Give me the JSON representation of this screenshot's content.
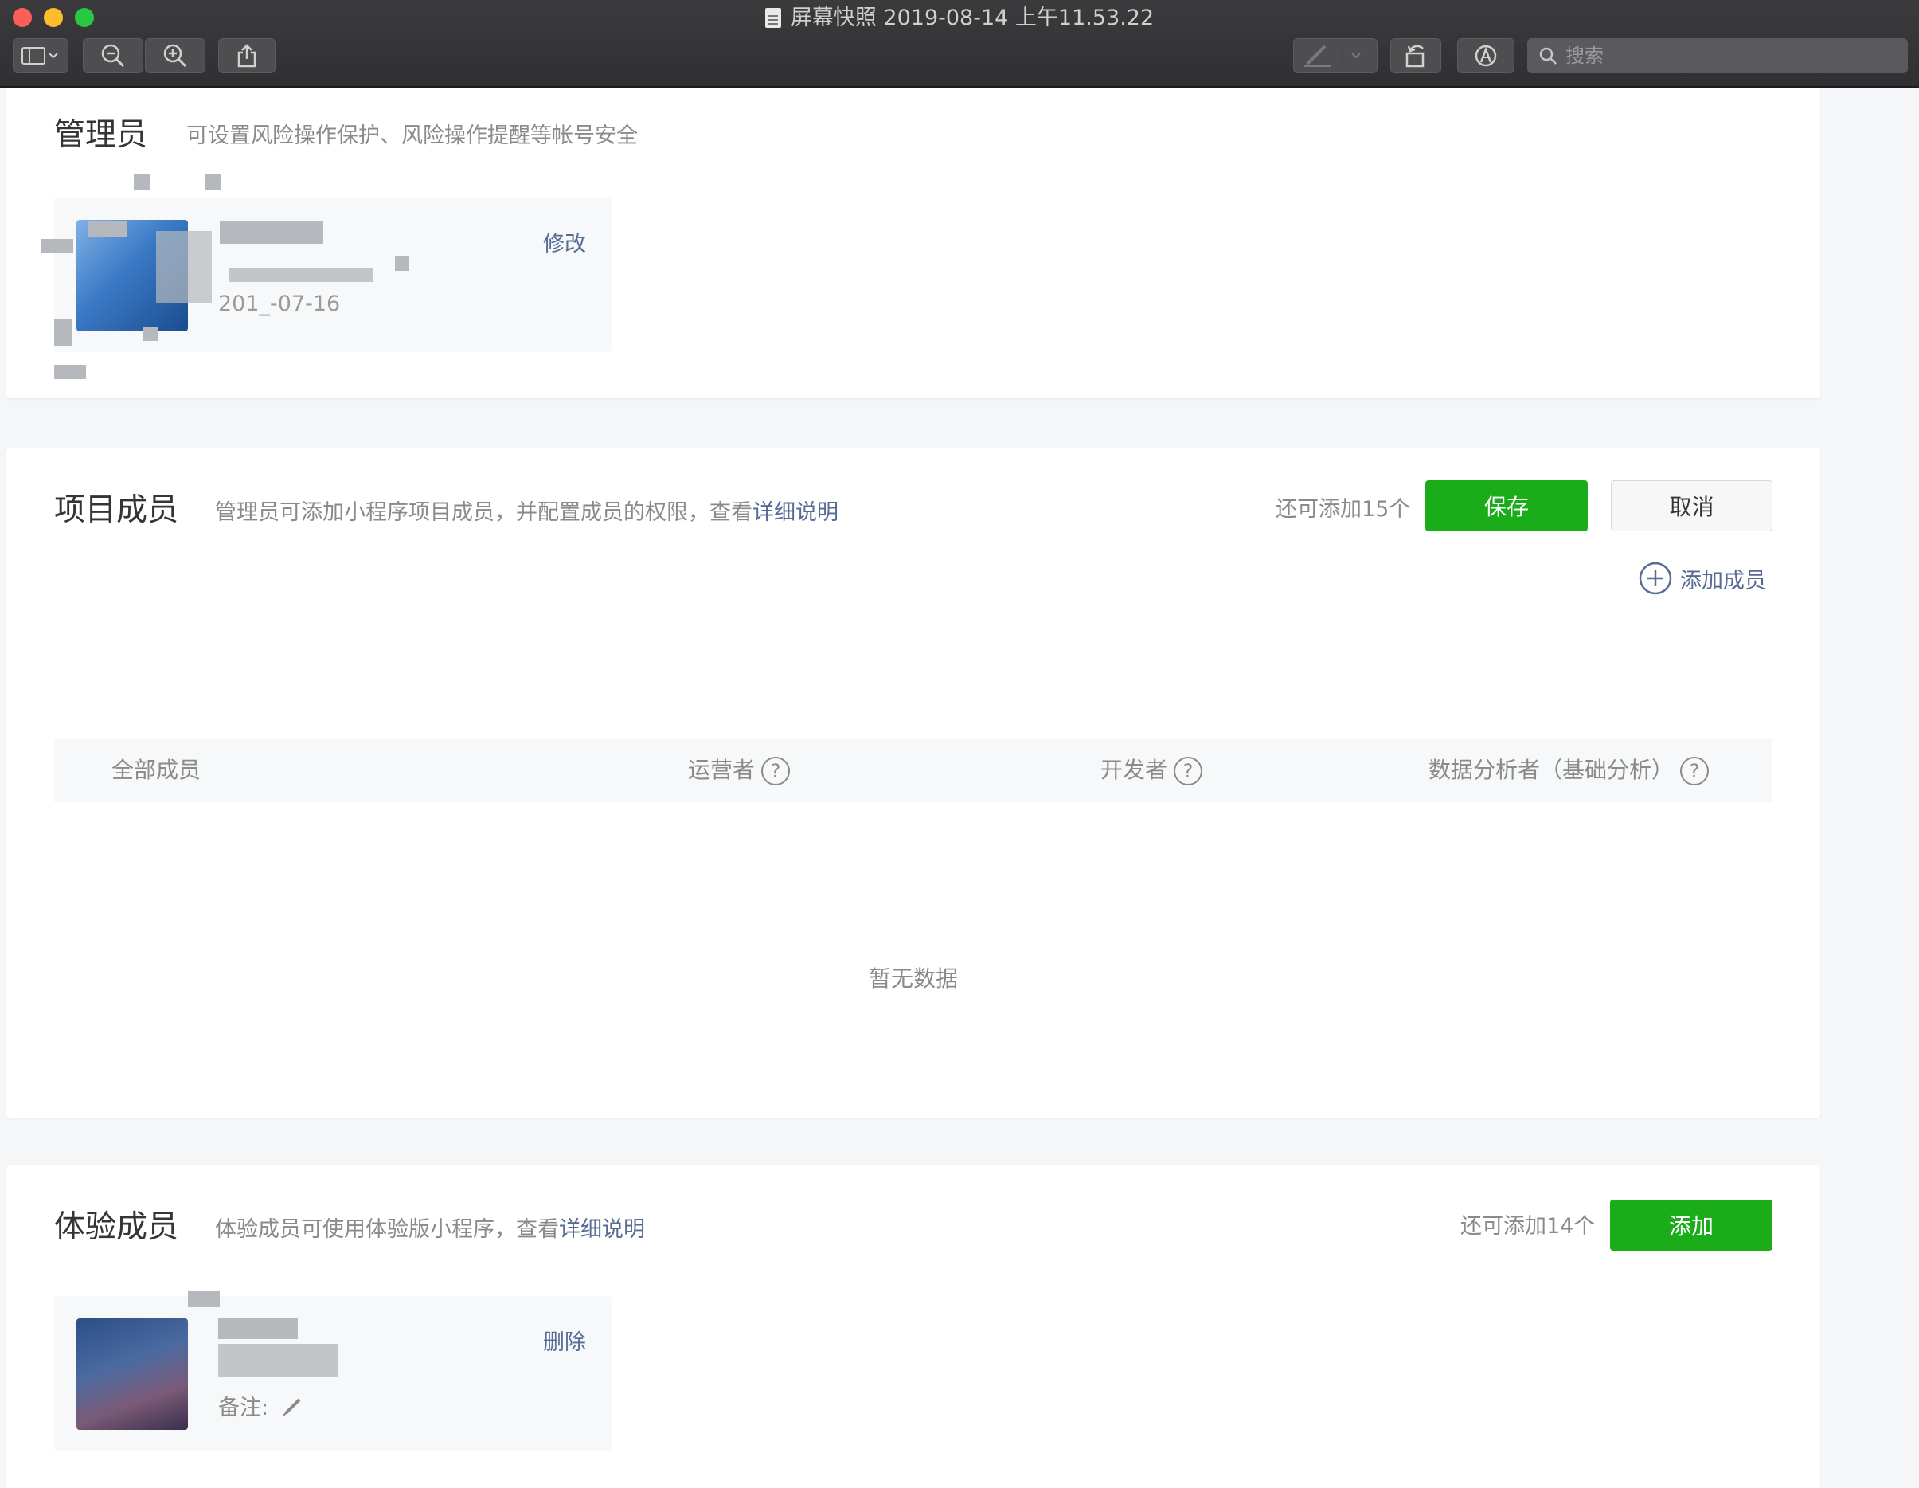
{
  "window": {
    "title": "屏幕快照 2019-08-14 上午11.53.22",
    "search_placeholder": "搜索"
  },
  "toolbar": {
    "icons": [
      "sidebar-icon",
      "zoom-out-icon",
      "zoom-in-icon",
      "share-icon",
      "markup-pen-icon",
      "rotate-icon",
      "annotate-icon",
      "search-icon"
    ]
  },
  "admin": {
    "title": "管理员",
    "desc": "可设置风险操作保护、风险操作提醒等帐号安全",
    "edit_label": "修改",
    "date_partial": "201_-07-16"
  },
  "project": {
    "title": "项目成员",
    "desc": "管理员可添加小程序项目成员，并配置成员的权限，查看",
    "desc_link": "详细说明",
    "remain": "还可添加15个",
    "save_label": "保存",
    "cancel_label": "取消",
    "add_member_label": "添加成员",
    "columns": [
      "全部成员",
      "运营者",
      "开发者",
      "数据分析者（基础分析）"
    ],
    "empty_text": "暂无数据"
  },
  "trial": {
    "title": "体验成员",
    "desc": "体验成员可使用体验版小程序，查看",
    "desc_link": "详细说明",
    "remain": "还可添加14个",
    "add_label": "添加",
    "delete_label": "删除",
    "remark_label": "备注:"
  },
  "colors": {
    "primary_green": "#1aad19",
    "link_blue": "#576b95",
    "text_gray": "#8a8a8a"
  }
}
